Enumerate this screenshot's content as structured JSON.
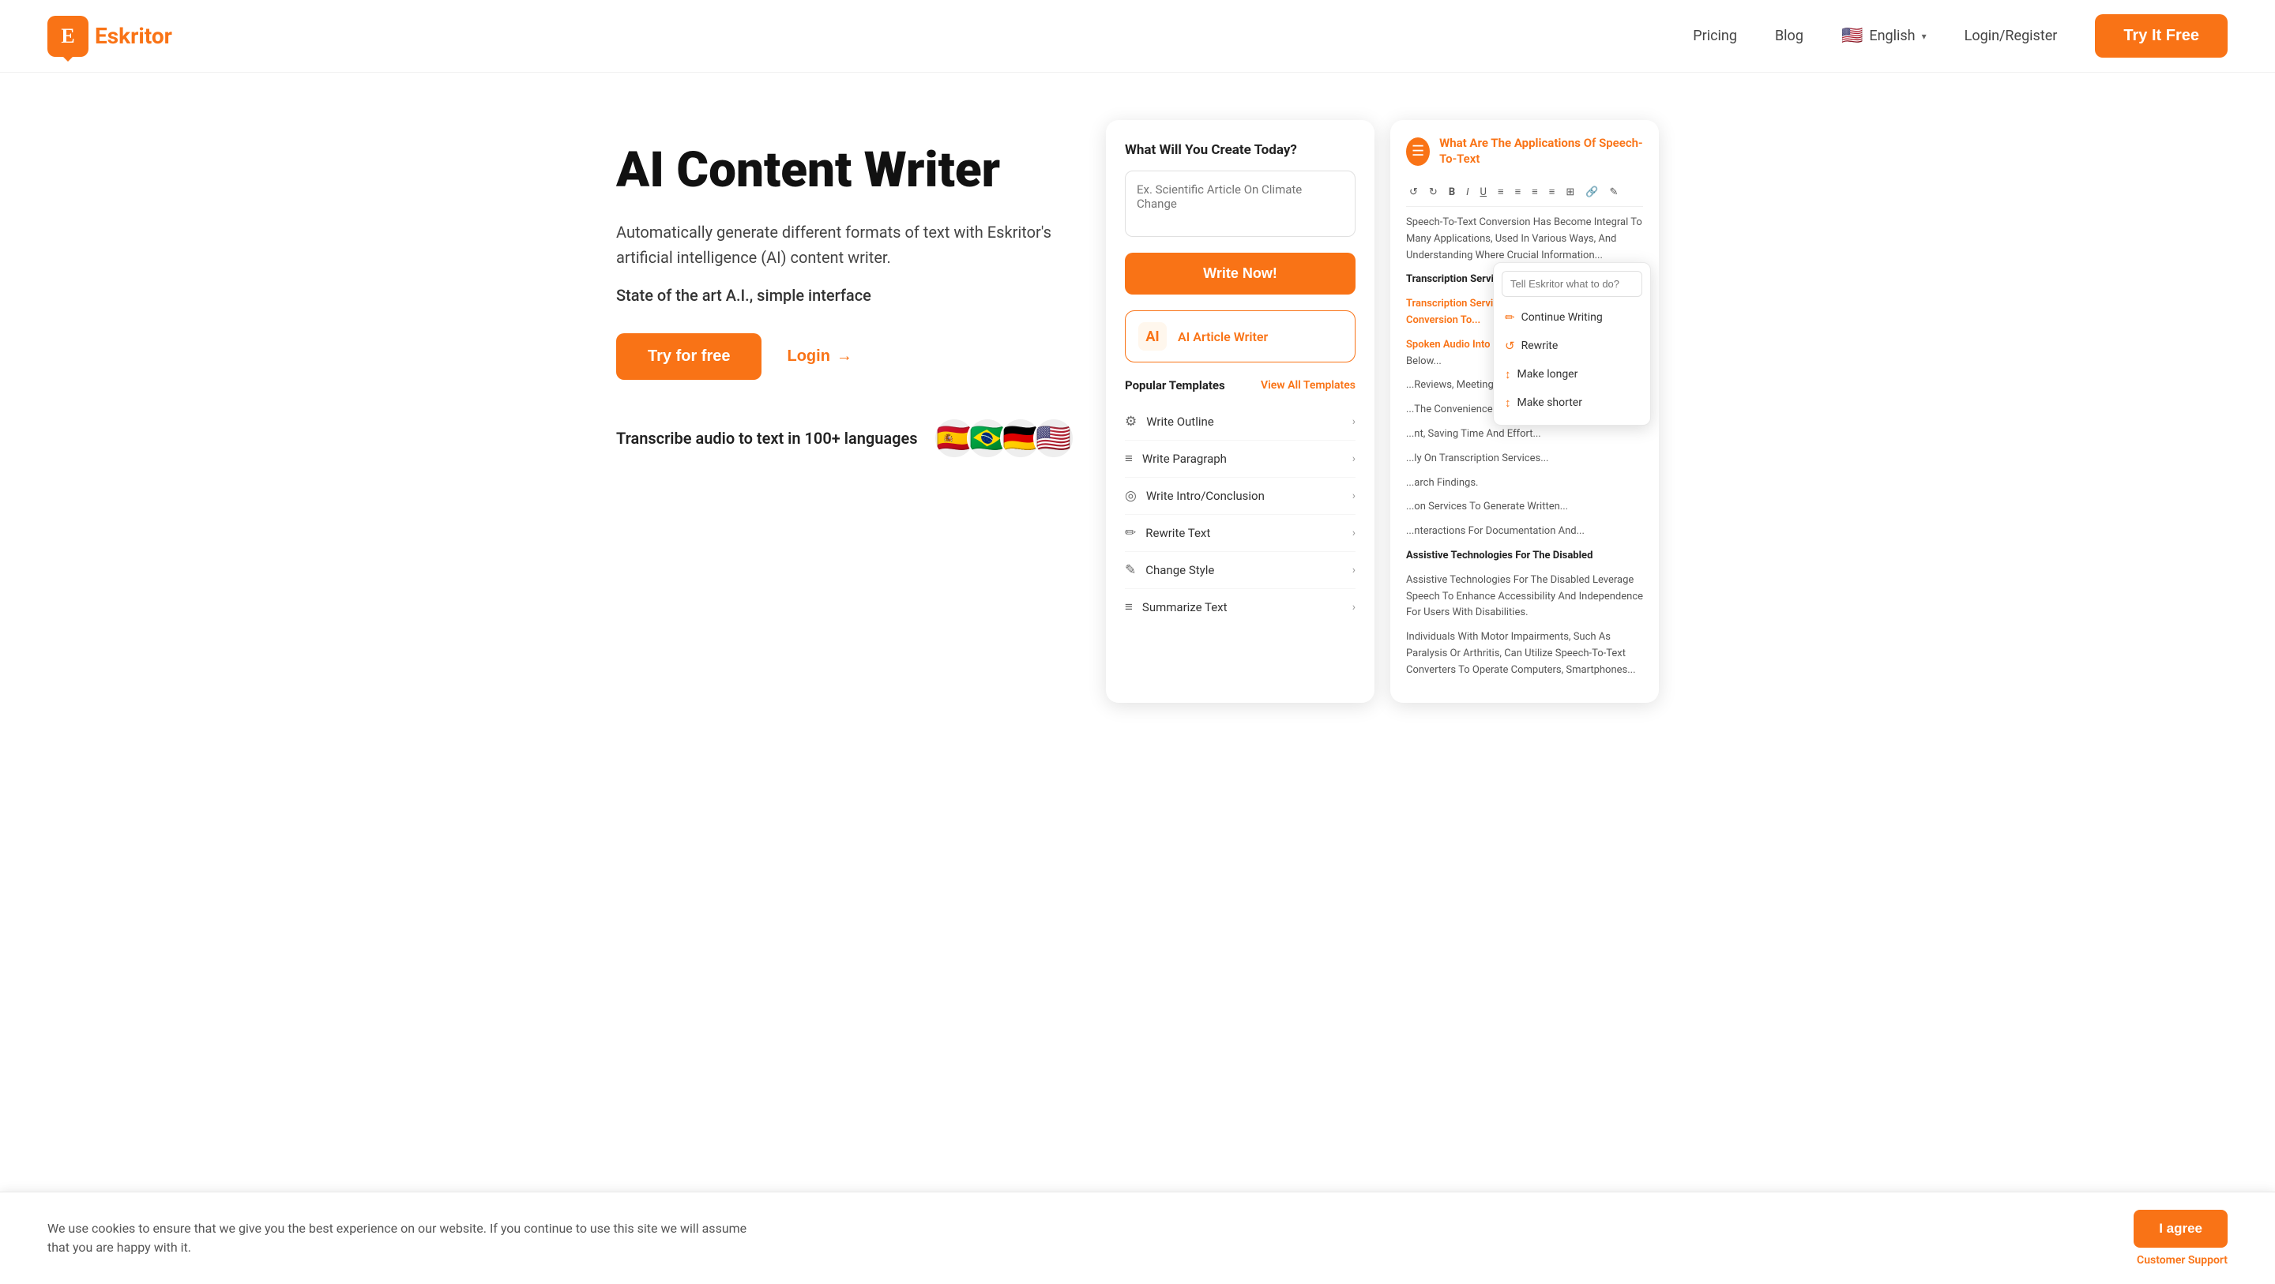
{
  "navbar": {
    "logo_letter": "E",
    "logo_text_start": "E",
    "logo_text_rest": "skritor",
    "nav_pricing": "Pricing",
    "nav_blog": "Blog",
    "nav_lang_flag": "🇺🇸",
    "nav_lang": "English",
    "nav_lang_chevron": "▾",
    "nav_register": "Login/Register",
    "btn_try_free": "Try It Free"
  },
  "hero": {
    "title": "AI Content Writer",
    "desc": "Automatically generate different formats of text with Eskritor's artificial intelligence (AI) content writer.",
    "subtitle": "State of the art A.I., simple interface",
    "btn_try": "Try for free",
    "btn_login": "Login",
    "btn_login_arrow": "→",
    "transcribe_text": "Transcribe audio to text in 100+ languages",
    "flags": [
      "🇪🇸",
      "🇧🇷",
      "🇩🇪",
      "🇺🇸"
    ]
  },
  "card_left": {
    "title": "What Will You Create Today?",
    "input_placeholder": "Ex. Scientific Article On Climate Change",
    "btn_write_now": "Write Now!",
    "ai_article_label": "AI Article Writer",
    "ai_article_icon": "AI",
    "templates_title": "Popular Templates",
    "view_all": "View All Templates",
    "templates": [
      {
        "icon": "⚙",
        "label": "Write Outline"
      },
      {
        "icon": "≡",
        "label": "Write Paragraph"
      },
      {
        "icon": "◎",
        "label": "Write Intro/Conclusion"
      },
      {
        "icon": "✏",
        "label": "Rewrite Text"
      },
      {
        "icon": "✎",
        "label": "Change Style"
      },
      {
        "icon": "≡",
        "label": "Summarize Text"
      }
    ]
  },
  "card_right": {
    "menu_icon": "☰",
    "title_start": "What Are The Applications ",
    "title_highlight": "Of Speech-To-Text",
    "toolbar": [
      "↺",
      "↻",
      "B",
      "I",
      "U",
      "≡",
      "≡",
      "≡",
      "≡",
      "⊞",
      "🔗",
      "✎"
    ],
    "content_intro": "Speech-To-Text Conversion Has Become Integral To Many Applications, Used In Various Ways, And Understanding Where Crucial Information...",
    "section1": "Transcription Services",
    "section1_text1_highlight": "Transcription Services Leverage Speech-To-Text Conversion To Transcribe",
    "section1_text2": "Spoken Audio Into Written Text Efficiently. Factors Below...",
    "section1_text3": "...Reviews, Meetings, Lectures, And...",
    "section2_text": "...The Convenience Of Quickly And Accurately...",
    "section2_text2": "...nt, Saving Time And Effort....",
    "section2_text3": "...ly On Transcription Services...",
    "section2_text4": "...arch Findings.",
    "section3_text": "...on Services To Generate Written...",
    "section3_text2": "...nteractions For Documentation And...",
    "section4": "Assistive Technologies For The Disabled",
    "section4_text": "Assistive Technologies For The Disabled Leverage Speech To Enhance Accessibility And Independence For Users With Disabilities.",
    "section4_text2": "Individuals With Motor Impairments, Such As Paralysis Or Arthritis, Can Utilize Speech-To-Text Converters To Operate Computers, Smartphones...",
    "dropdown": {
      "placeholder": "Tell Eskritor what to do?",
      "items": [
        {
          "icon": "✏",
          "label": "Continue Writing"
        },
        {
          "icon": "↺",
          "label": "Rewrite"
        },
        {
          "icon": "↕",
          "label": "Make longer"
        },
        {
          "icon": "↕",
          "label": "Make shorter"
        }
      ]
    }
  },
  "cookie": {
    "text": "We use cookies to ensure that we give you the best experience on our website. If you continue to use this site we will assume that you are happy with it.",
    "btn_agree": "I agree",
    "customer_support": "Customer Support"
  }
}
